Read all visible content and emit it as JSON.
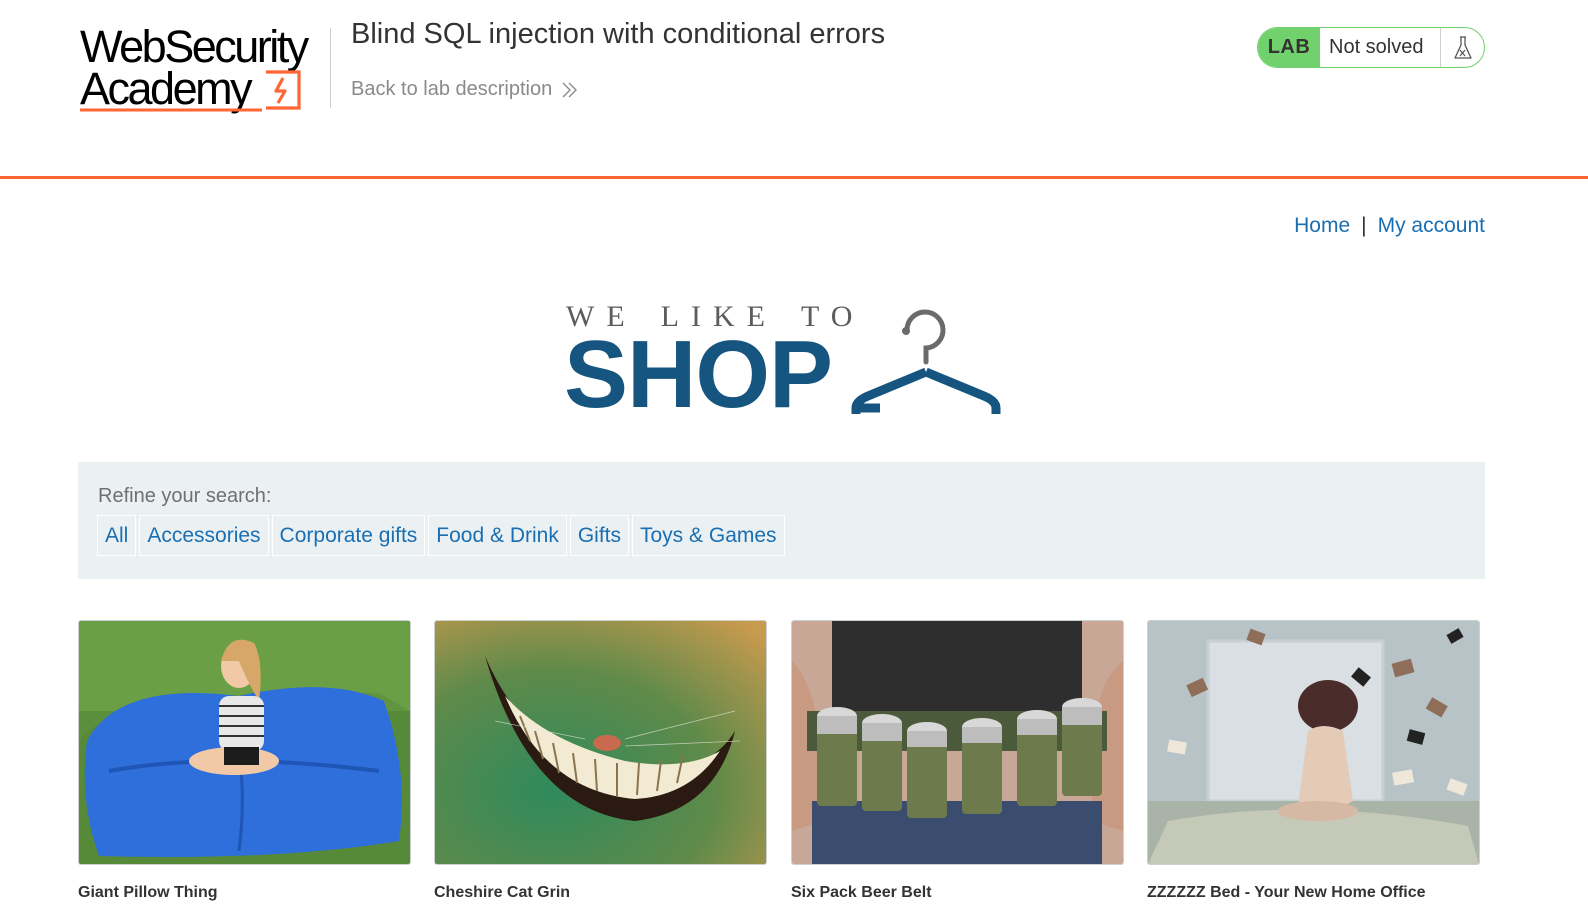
{
  "academy": {
    "logo_line1": "WebSecurity",
    "logo_line2": "Academy",
    "lab_title": "Blind SQL injection with conditional errors",
    "back_link": "Back to lab description",
    "lab_badge": "LAB",
    "lab_status": "Not solved",
    "colors": {
      "accent": "#ff6633",
      "lab_green": "#70d16d"
    }
  },
  "nav": {
    "home": "Home",
    "separator": "|",
    "account": "My account"
  },
  "shop_logo": {
    "tagline": [
      "WE",
      "LIKE",
      "TO"
    ],
    "name": "SHOP",
    "color": "#15557f"
  },
  "filters": {
    "label": "Refine your search:",
    "items": [
      "All",
      "Accessories",
      "Corporate gifts",
      "Food & Drink",
      "Gifts",
      "Toys & Games"
    ]
  },
  "products": [
    {
      "name": "Giant Pillow Thing"
    },
    {
      "name": "Cheshire Cat Grin"
    },
    {
      "name": "Six Pack Beer Belt"
    },
    {
      "name": "ZZZZZZ Bed - Your New Home Office"
    }
  ]
}
